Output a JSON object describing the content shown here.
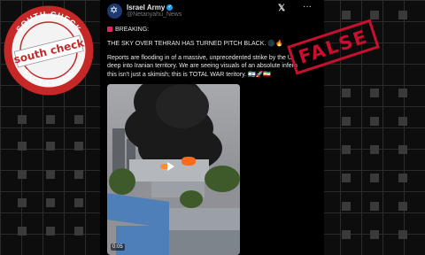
{
  "post": {
    "account_name": "Israel Army",
    "handle": "@Netanyahu_News",
    "platform_icon": "x-logo-icon",
    "more_icon": "more-icon",
    "breaking_label": "BREAKING:",
    "headline": "THE SKY OVER TEHRAN HAS TURNED PITCH BLACK. 🌑🔥",
    "body_lines": [
      "Reports are flooding in of a massive, unprecedented strike by the U.",
      "deep into Iranian territory. We are seeing visuals of an absolute infern",
      "this isn't just a skimish; this is TOTAL WAR teritory. 🇮🇱🚀🇮🇷"
    ],
    "video": {
      "timestamp": "0:05",
      "play_icon": "play-icon"
    }
  },
  "overlay": {
    "stamp_text": "FALSE",
    "seal": {
      "top_text": "SOUTH CHECK",
      "brand_text": "south check",
      "bottom_text": "FACT-CHECK"
    }
  },
  "colors": {
    "stamp_red": "#c8102e",
    "seal_green": "#2e7d32",
    "seal_red": "#c62828",
    "background": "#0d0d0d"
  }
}
